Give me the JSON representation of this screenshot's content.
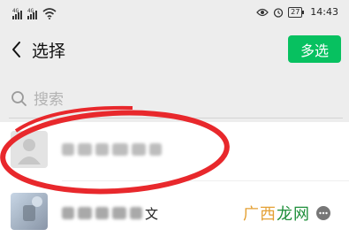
{
  "status_bar": {
    "signal_1_label": "4G",
    "signal_2_label": "4G",
    "battery": "27",
    "time": "14:43"
  },
  "nav": {
    "title": "选择",
    "multi_select_label": "多选"
  },
  "search": {
    "placeholder": "搜索"
  },
  "list": {
    "items": [
      {
        "avatar": "default-avatar",
        "name_tail": ""
      },
      {
        "avatar": "photo-avatar",
        "name_tail": "文"
      }
    ]
  },
  "annotation": {
    "color": "#e8282c"
  },
  "watermark": {
    "text_part_1": "广西",
    "text_part_2": "龙网",
    "color_1": "#e4a135",
    "color_2": "#1e8f3a"
  },
  "colors": {
    "accent": "#07c160",
    "background": "#ededed"
  }
}
